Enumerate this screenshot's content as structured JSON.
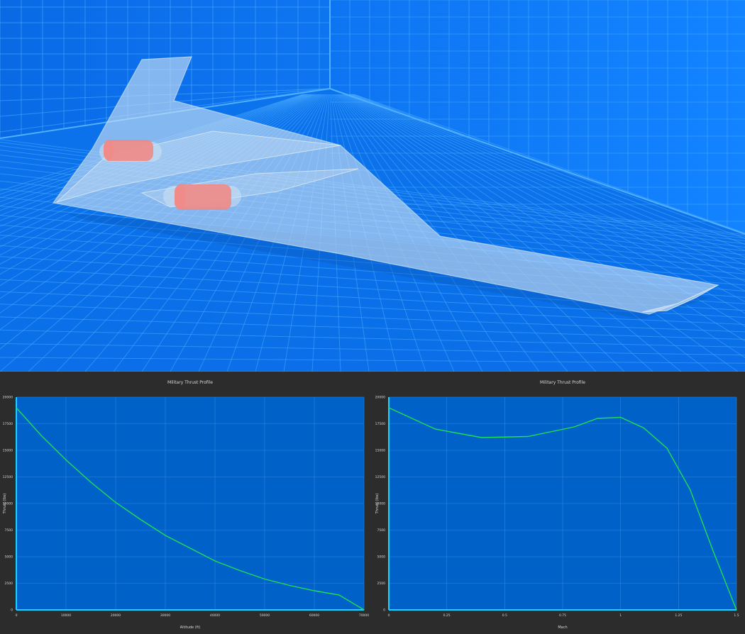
{
  "viewport": {
    "name": "3D aircraft model view",
    "background_color": "#0a73f0",
    "grid_color": "#4fb0ff",
    "wing_color": "#cfe2f3",
    "engine_color": "#f08a86"
  },
  "colors": {
    "plot_background": "#0061c8",
    "panel_background": "#2c2c2c",
    "line": "#1ee050",
    "axis": "#19d3ff",
    "text": "#d8d8d8"
  },
  "chart_data": [
    {
      "type": "line",
      "title": "Military Thrust Profile",
      "xlabel": "Altitude (ft)",
      "ylabel": "Thrust (lbs)",
      "xlim": [
        0,
        70000
      ],
      "ylim": [
        0,
        20000
      ],
      "xticks": [
        "0",
        "10000",
        "20000",
        "30000",
        "40000",
        "50000",
        "60000",
        "70000"
      ],
      "yticks": [
        "0",
        "2500",
        "5000",
        "7500",
        "10000",
        "12500",
        "15000",
        "17500",
        "20000"
      ],
      "grid": true,
      "series": [
        {
          "x": [
            0,
            5000,
            10000,
            15000,
            20000,
            25000,
            30000,
            35000,
            40000,
            45000,
            50000,
            55000,
            60000,
            65000,
            70000
          ],
          "y": [
            19000,
            16400,
            14100,
            12000,
            10100,
            8500,
            7000,
            5800,
            4600,
            3700,
            2900,
            2300,
            1800,
            1400,
            0
          ]
        }
      ]
    },
    {
      "type": "line",
      "title": "Military Thrust Profile",
      "xlabel": "Mach",
      "ylabel": "Thrust (lbs)",
      "xlim": [
        0,
        1.5
      ],
      "ylim": [
        0,
        20000
      ],
      "xticks": [
        "0",
        "0.25",
        "0.5",
        "0.75",
        "1",
        "1.25",
        "1.5"
      ],
      "yticks": [
        "0",
        "2500",
        "5000",
        "7500",
        "10000",
        "12500",
        "15000",
        "17500",
        "20000"
      ],
      "grid": true,
      "series": [
        {
          "x": [
            0,
            0.2,
            0.4,
            0.6,
            0.8,
            0.9,
            1.0,
            1.1,
            1.2,
            1.3,
            1.4,
            1.5
          ],
          "y": [
            19000,
            17000,
            16200,
            16300,
            17200,
            18000,
            18100,
            17100,
            15200,
            11300,
            5500,
            0
          ]
        }
      ]
    }
  ]
}
